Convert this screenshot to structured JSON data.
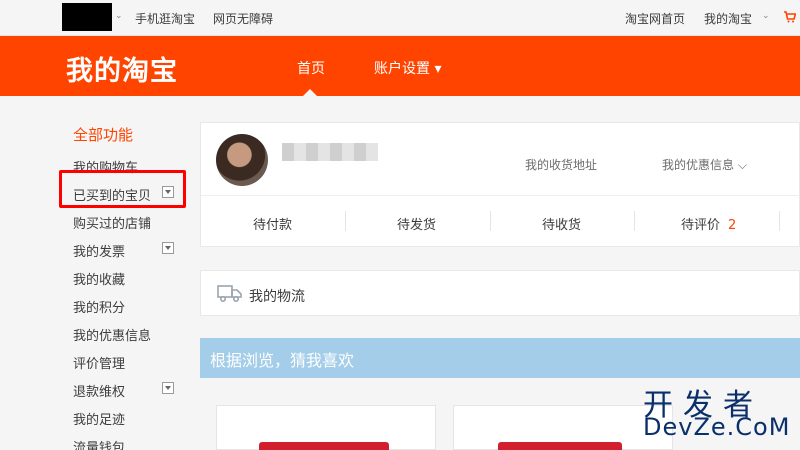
{
  "topbar": {
    "left_links": [
      "手机逛淘宝",
      "网页无障碍"
    ],
    "home_link": "淘宝网首页",
    "my_taobao": "我的淘宝",
    "caret": "⌄"
  },
  "header": {
    "brand": "我的淘宝",
    "nav_home": "首页",
    "nav_account": "账户设置 ▾",
    "accent_color": "#ff4400"
  },
  "sidebar": {
    "heading": "全部功能",
    "items": [
      "我的购物车",
      "已买到的宝贝",
      "购买过的店铺",
      "我的发票",
      "我的收藏",
      "我的积分",
      "我的优惠信息",
      "评价管理",
      "退款维权",
      "我的足迹",
      "流量钱包"
    ]
  },
  "user_card": {
    "address_link": "我的收货地址",
    "coupon_link": "我的优惠信息 ⌵",
    "orders": [
      {
        "label": "待付款",
        "count": ""
      },
      {
        "label": "待发货",
        "count": ""
      },
      {
        "label": "待收货",
        "count": ""
      },
      {
        "label": "待评价",
        "count": "2"
      }
    ]
  },
  "logistics": {
    "title": "我的物流"
  },
  "recommend": {
    "title": "根据浏览，猜我喜欢",
    "banner_color": "#a3cde9"
  },
  "watermark": {
    "cn": "开发者",
    "en": "DevZe.CoM"
  }
}
